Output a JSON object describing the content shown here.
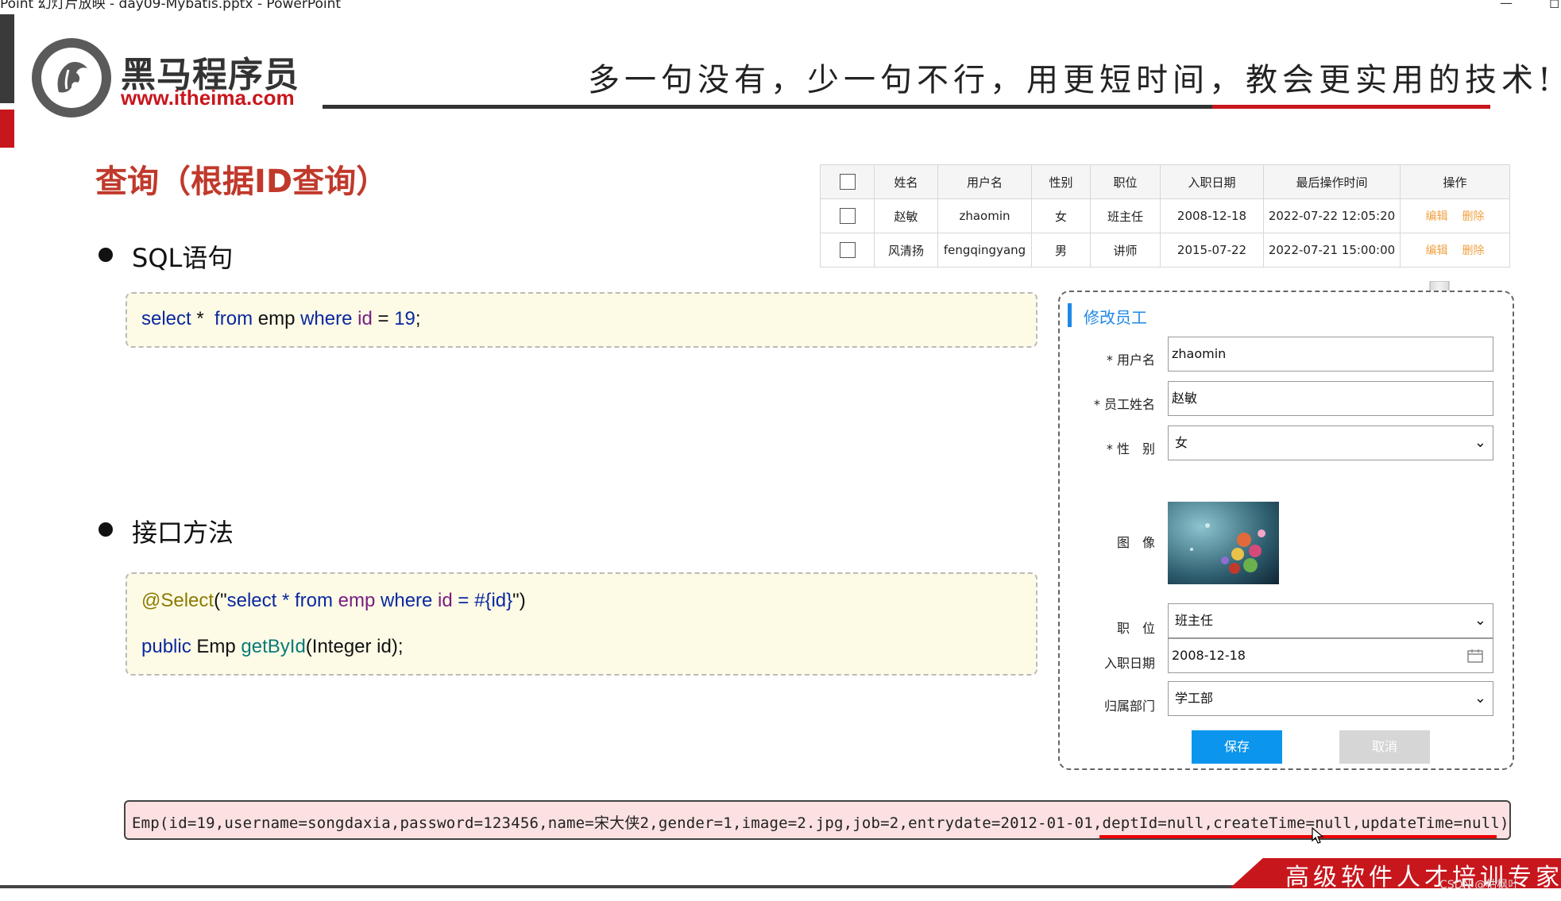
{
  "window": {
    "title": "Point 幻灯片放映 - day09-Mybatis.pptx - PowerPoint",
    "minimize": "—",
    "restore": "◻"
  },
  "header": {
    "logo_cn": "黑马程序员",
    "logo_url": "www.itheima.com",
    "slogan": "多一句没有，少一句不行，用更短时间，教会更实用的技术!"
  },
  "page_title": "查询（根据ID查询）",
  "sections": [
    {
      "label": "SQL语句",
      "code": {
        "t1": "select",
        "t2": " * ",
        "t3": " from",
        "t4": " emp ",
        "t5": "where",
        "t6": " id",
        "t7": " = ",
        "t8": "19",
        "t9": ";"
      }
    },
    {
      "label": "接口方法",
      "code": {
        "ann": "@Select",
        "p1": "(\"",
        "s1": "select",
        "s2": " * ",
        "s3": "from",
        "s4": " emp",
        "s5": " where",
        "s6": " id",
        "s7": " = #{id}",
        "p2": "\")",
        "m1": "public",
        "m2": " Emp ",
        "m3": "getById",
        "m4": "(Integer id);"
      }
    }
  ],
  "table": {
    "headers": [
      "姓名",
      "用户名",
      "性别",
      "职位",
      "入职日期",
      "最后操作时间",
      "操作"
    ],
    "rows": [
      {
        "name": "赵敏",
        "username": "zhaomin",
        "gender": "女",
        "job": "班主任",
        "entry": "2008-12-18",
        "updated": "2022-07-22 12:05:20",
        "edit": "编辑",
        "delete": "删除"
      },
      {
        "name": "风清扬",
        "username": "fengqingyang",
        "gender": "男",
        "job": "讲师",
        "entry": "2015-07-22",
        "updated": "2022-07-21 15:00:00",
        "edit": "编辑",
        "delete": "删除"
      }
    ]
  },
  "form": {
    "title": "修改员工",
    "username_label": "* 用户名",
    "username_value": "zhaomin",
    "name_label": "* 员工姓名",
    "name_value": "赵敏",
    "gender_label": "* 性　别",
    "gender_value": "女",
    "image_label": "图　像",
    "job_label": "职　位",
    "job_value": "班主任",
    "entry_label": "入职日期",
    "entry_value": "2008-12-18",
    "dept_label": "归属部门",
    "dept_value": "学工部",
    "save": "保存",
    "cancel": "取消"
  },
  "output": "Emp(id=19,username=songdaxia,password=123456,name=宋大侠2,gender=1,image=2.jpg,job=2,entrydate=2012-01-01,deptId=null,createTime=null,updateTime=null)",
  "footer": {
    "text": "高级软件人才培训专家",
    "watermark": "CSDN @枯枫叶"
  }
}
